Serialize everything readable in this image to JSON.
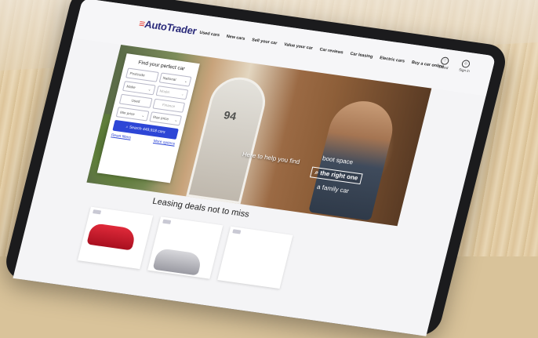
{
  "header": {
    "logo_text": "AutoTrader",
    "nav": [
      "Used cars",
      "New cars",
      "Sell your car",
      "Value your car",
      "Car reviews",
      "Car leasing",
      "Electric cars",
      "Buy a car online"
    ],
    "icons": [
      {
        "icon": "heart-icon",
        "label": "Saved"
      },
      {
        "icon": "user-icon",
        "label": "Sign in"
      }
    ]
  },
  "search_panel": {
    "title": "Find your perfect car",
    "postcode": "Postcode",
    "distance": "National",
    "make": "Make",
    "model": "Model",
    "used": "Used",
    "finance": "Finance",
    "min_price": "Min price",
    "max_price": "Max price",
    "search_button": "Search 449,918 cars",
    "reset_filters": "Reset filters",
    "more_options": "More options"
  },
  "hero": {
    "door_number": "94",
    "slogan_main": "Here to help you find",
    "slogan_alt": "boot space",
    "slogan_highlight": "the right one",
    "slogan_end": "a family car"
  },
  "leasing": {
    "title": "Leasing deals not to miss"
  },
  "colors": {
    "brand_blue": "#2d46d6",
    "logo_red": "#e83a31",
    "logo_navy": "#2a2a7a",
    "car_red": "#c8182a"
  }
}
